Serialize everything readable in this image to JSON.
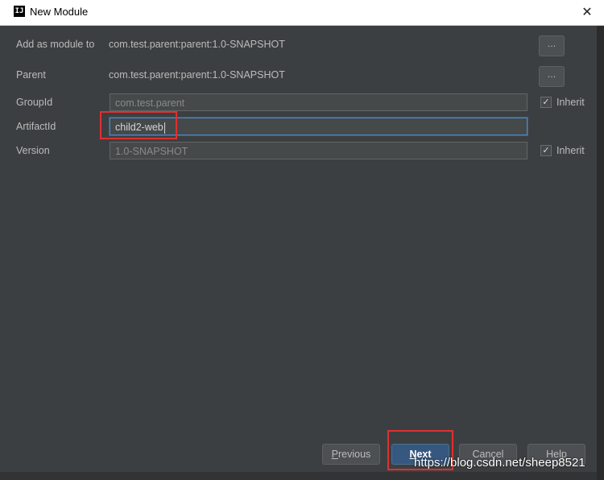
{
  "window": {
    "title": "New Module",
    "app_icon_glyph": "IJ",
    "close_glyph": "✕"
  },
  "form": {
    "add_as_module": {
      "label": "Add as module to",
      "value": "com.test.parent:parent:1.0-SNAPSHOT",
      "browse": "..."
    },
    "parent": {
      "label": "Parent",
      "value": "com.test.parent:parent:1.0-SNAPSHOT",
      "browse": "..."
    },
    "group_id": {
      "label": "GroupId",
      "value": "com.test.parent",
      "inherit_label": "Inherit",
      "inherit_checked": true
    },
    "artifact_id": {
      "label": "ArtifactId",
      "value": "child2-web"
    },
    "version": {
      "label": "Version",
      "value": "1.0-SNAPSHOT",
      "inherit_label": "Inherit",
      "inherit_checked": true
    }
  },
  "buttons": {
    "previous_first": "P",
    "previous_rest": "revious",
    "next_first": "N",
    "next_rest": "ext",
    "cancel": "Cancel",
    "help": "Help"
  },
  "watermark": "https://blog.csdn.net/sheep8521",
  "check_glyph": "✓",
  "colors": {
    "background": "#3c3f41",
    "primary_button": "#365880",
    "highlight": "#e03030",
    "focus": "#4a88c7"
  }
}
